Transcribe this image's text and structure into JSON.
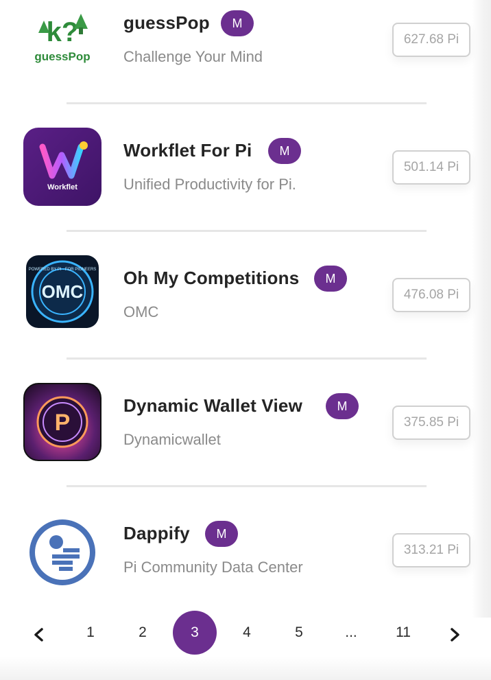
{
  "apps": [
    {
      "name": "guessPop",
      "badge": "M",
      "subtitle": "Challenge Your Mind",
      "price": "627.68 Pi",
      "icon_text": "guessPop"
    },
    {
      "name": "Workflet For Pi",
      "badge": "M",
      "subtitle": "Unified Productivity for Pi.",
      "price": "501.14 Pi",
      "icon_text": "Workflet"
    },
    {
      "name": "Oh My Competitions",
      "badge": "M",
      "subtitle": "OMC",
      "price": "476.08 Pi",
      "icon_text": "OMC",
      "icon_ring_text": "POWERED BY PI · FOR PIONEERS"
    },
    {
      "name": "Dynamic Wallet View",
      "badge": "M",
      "subtitle": "Dynamicwallet",
      "price": "375.85 Pi",
      "icon_text": "P"
    },
    {
      "name": "Dappify",
      "badge": "M",
      "subtitle": "Pi Community Data Center",
      "price": "313.21 Pi"
    }
  ],
  "pagination": {
    "prev_icon": "chevron-left-icon",
    "next_icon": "chevron-right-icon",
    "pages": [
      "1",
      "2",
      "3",
      "4",
      "5",
      "...",
      "11"
    ],
    "current": "3"
  },
  "colors": {
    "accent": "#6b2f8f",
    "price_border": "#d0d0d0",
    "subtitle": "#8a8a8a"
  }
}
